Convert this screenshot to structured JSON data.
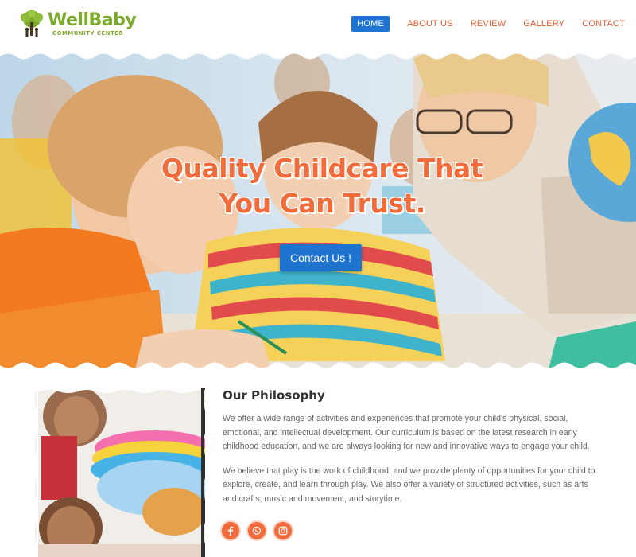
{
  "brand": {
    "name": "WellBaby",
    "subtitle": "COMMUNITY CENTER"
  },
  "nav": {
    "items": [
      {
        "label": "HOME",
        "active": true
      },
      {
        "label": "ABOUT US",
        "active": false
      },
      {
        "label": "REVIEW",
        "active": false
      },
      {
        "label": "GALLERY",
        "active": false
      },
      {
        "label": "CONTACT",
        "active": false
      }
    ]
  },
  "hero": {
    "title_line1": "Quality Childcare That",
    "title_line2": "You Can Trust.",
    "cta_label": "Contact Us !"
  },
  "philosophy": {
    "title": "Our Philosophy",
    "paragraph1": "We offer a wide range of activities and experiences that promote your child's physical, social, emotional, and intellectual development. Our curriculum is based on the latest research in early childhood education, and we are always looking for new and innovative ways to engage your child.",
    "paragraph2": "We believe that play is the work of childhood, and we provide plenty of opportunities for your child to explore, create, and learn through play. We also offer a variety of structured activities, such as arts and crafts, music and movement, and storytime."
  },
  "socials": [
    {
      "icon": "facebook-icon"
    },
    {
      "icon": "whatsapp-icon"
    },
    {
      "icon": "instagram-icon"
    }
  ],
  "colors": {
    "accent_orange": "#f26b3a",
    "nav_active_blue": "#1f74d1",
    "brand_green": "#7cab2b",
    "body_text": "#666666"
  }
}
